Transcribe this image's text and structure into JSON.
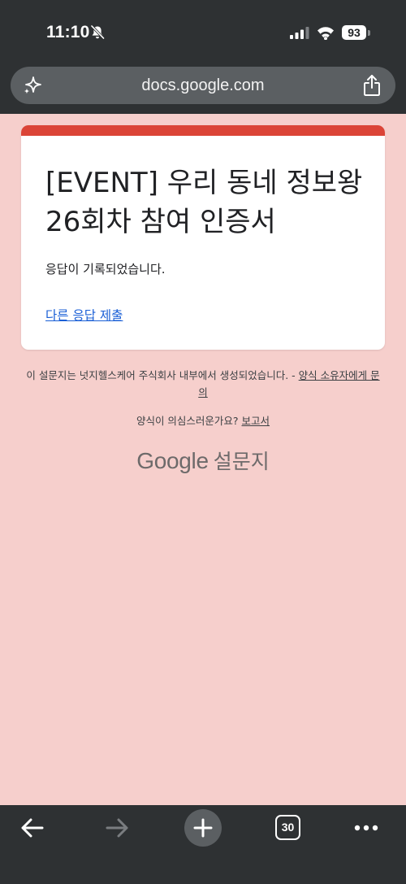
{
  "status_bar": {
    "time": "11:10",
    "battery": "93",
    "icons": [
      "bell-slash-icon",
      "signal-icon",
      "wifi-icon",
      "battery-icon"
    ]
  },
  "browser": {
    "url": "docs.google.com",
    "tab_count": "30",
    "icons": [
      "sparkle-icon",
      "share-icon",
      "back-arrow-icon",
      "forward-arrow-icon",
      "plus-icon",
      "more-dots-icon"
    ]
  },
  "form": {
    "title": "[EVENT] 우리 동네 정보왕 26회차 참여 인증서",
    "confirmation": "응답이 기록되었습니다.",
    "resubmit_link": "다른 응답 제출",
    "accent_color": "#db4437",
    "background_color": "#f6cfcc"
  },
  "footer": {
    "disclaimer_text": "이 설문지는 넛지헬스케어 주식회사 내부에서 생성되었습니다. - ",
    "owner_link": "양식 소유자에게 문의",
    "report_prompt": "양식이 의심스러운가요? ",
    "report_link": "보고서",
    "logo_google": "Google",
    "logo_forms": "설문지"
  }
}
